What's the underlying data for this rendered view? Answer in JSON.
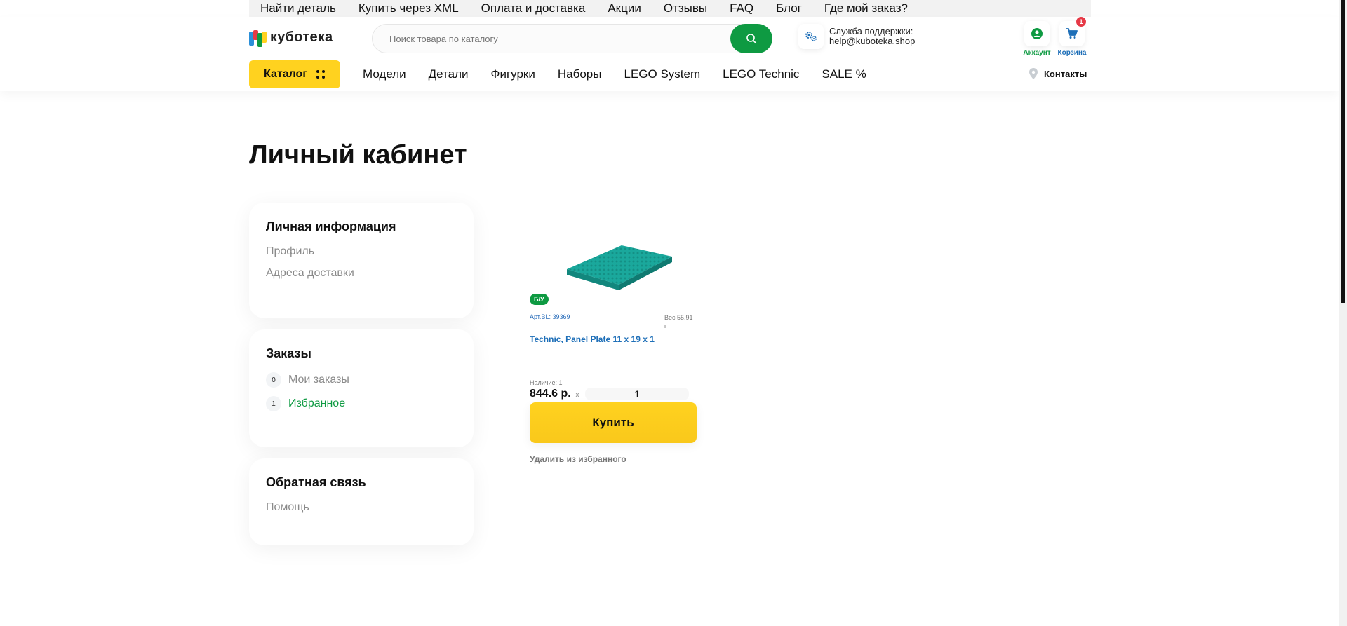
{
  "topnav": {
    "items": [
      "Найти деталь",
      "Купить через XML",
      "Оплата и доставка",
      "Акции",
      "Отзывы",
      "FAQ",
      "Блог",
      "Где мой заказ?"
    ]
  },
  "header": {
    "logo_text": "кубoтека",
    "search_placeholder": "Поиск товара по каталогу",
    "support_line1": "Служба поддержки:",
    "support_line2": "help@kuboteka.shop",
    "account_label": "Аккаунт",
    "cart_label": "Корзина",
    "cart_count": "1",
    "catalog_label": "Каталог",
    "categories": [
      "Модели",
      "Детали",
      "Фигурки",
      "Наборы",
      "LEGO System",
      "LEGO Technic",
      "SALE %"
    ],
    "contacts_label": "Контакты"
  },
  "page_title": "Личный кабинет",
  "sidebar": {
    "personal": {
      "title": "Личная информация",
      "links": [
        "Профиль",
        "Адреса доставки"
      ]
    },
    "orders": {
      "title": "Заказы",
      "items": [
        {
          "count": "0",
          "label": "Мои заказы"
        },
        {
          "count": "1",
          "label": "Избранное"
        }
      ]
    },
    "feedback": {
      "title": "Обратная связь",
      "links": [
        "Помощь"
      ]
    }
  },
  "product": {
    "badge": "Б/У",
    "article": "Арт.BL: 39369",
    "weight": "Вес 55.91 г",
    "name": "Technic, Panel Plate 11 x 19 x 1",
    "availability": "Наличие: 1",
    "price": "844.6 р.",
    "times": "x",
    "quantity": "1",
    "buy_label": "Купить",
    "remove_label": "Удалить из избранного"
  },
  "colors": {
    "accent_green": "#0e9a42",
    "accent_yellow": "#ffd21f",
    "link_blue": "#1e6fb8",
    "badge_red": "#e63946"
  }
}
